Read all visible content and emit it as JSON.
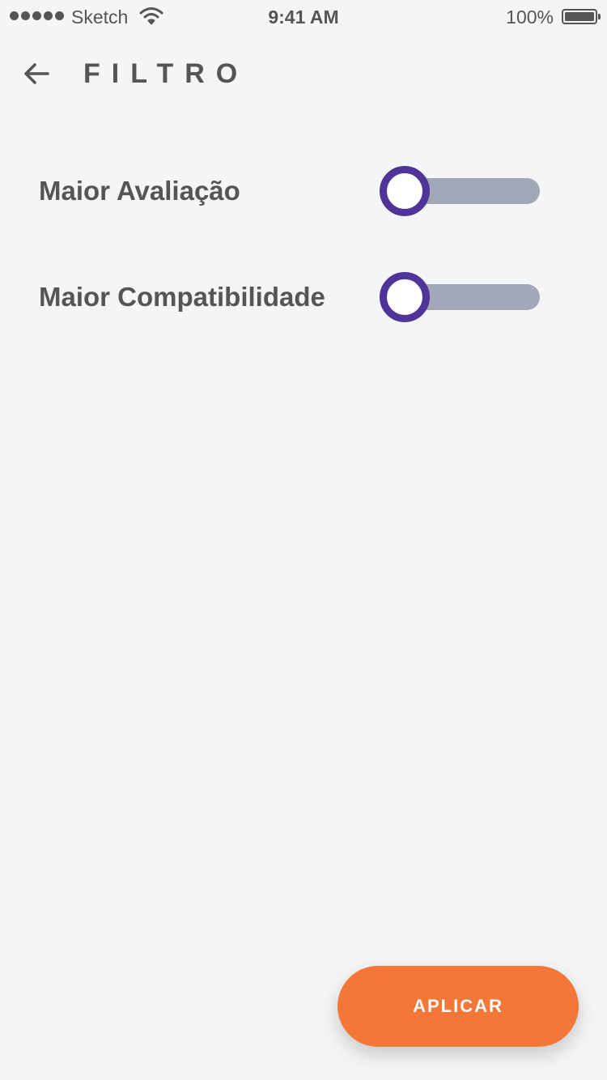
{
  "status_bar": {
    "carrier": "Sketch",
    "time": "9:41 AM",
    "battery": "100%"
  },
  "header": {
    "back_icon": "arrow-left-icon",
    "title": "FILTRO"
  },
  "filters": [
    {
      "label": "Maior Avaliação",
      "enabled": false
    },
    {
      "label": "Maior Compatibilidade",
      "enabled": false
    }
  ],
  "apply_button": {
    "label": "APLICAR"
  },
  "colors": {
    "background": "#f4f5f7",
    "text": "#555555",
    "toggle_accent": "#4e3597",
    "toggle_track": "#a3a8b8",
    "button": "#f37737"
  }
}
